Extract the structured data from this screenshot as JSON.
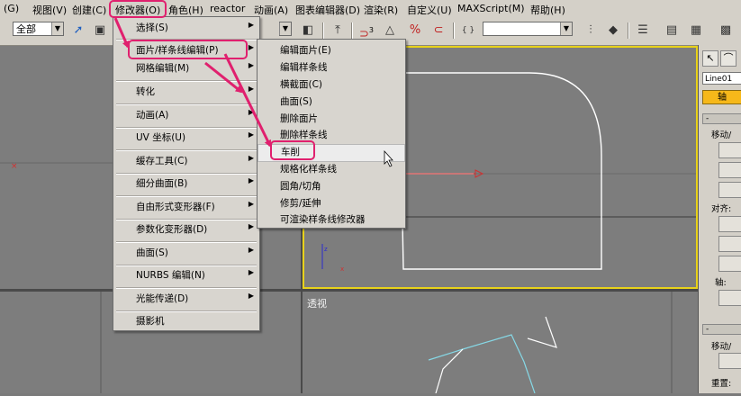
{
  "menubar": {
    "items": [
      "(G)",
      "视图(V)",
      "创建(C)",
      "修改器(O)",
      "角色(H)",
      "reactor",
      "动画(A)",
      "图表编辑器(D)",
      "渲染(R)",
      "自定义(U)",
      "MAXScript(M)",
      "帮助(H)"
    ]
  },
  "toolbar": {
    "selection_filter": "全部",
    "icons": [
      "select-arrow-icon",
      "select-region-icon",
      "mirror-icon",
      "snap-3d-icon",
      "angle-snap-icon",
      "percent-snap-icon",
      "spinner-snap-icon",
      "edit-named-selection-icon",
      "mirror-tool-icon",
      "align-tool-icon",
      "layer-manager-icon",
      "curve-editor-icon",
      "schematic-view-icon"
    ],
    "snap_label": "3"
  },
  "modifiers_menu": {
    "items": [
      "选择(S)",
      "面片/样条线编辑(P)",
      "网格编辑(M)",
      "转化",
      "动画(A)",
      "UV 坐标(U)",
      "缓存工具(C)",
      "细分曲面(B)",
      "自由形式变形器(F)",
      "参数化变形器(D)",
      "曲面(S)",
      "NURBS 编辑(N)",
      "光能传递(D)",
      "摄影机"
    ],
    "has_submenu": [
      true,
      true,
      true,
      true,
      true,
      true,
      true,
      true,
      true,
      true,
      true,
      true,
      true,
      false
    ]
  },
  "patch_spline_submenu": {
    "items": [
      "编辑面片(E)",
      "编辑样条线",
      "横截面(C)",
      "曲面(S)",
      "删除面片",
      "删除样条线",
      "车削",
      "规格化样条线",
      "圆角/切角",
      "修剪/延伸",
      "可渲染样条线修改器"
    ],
    "highlighted": "车削"
  },
  "viewports": {
    "perspective_label": "透视"
  },
  "command_panel": {
    "object_name": "Line01",
    "tab_label": "轴",
    "labels": [
      "移动/",
      "对齐:",
      "轴:",
      "移动/",
      "重置:"
    ]
  },
  "colors": {
    "highlight": "#e0206e",
    "active_viewport_border": "#e8d21a",
    "spline": "#ffffff",
    "axis_red": "#d23030",
    "perspective_wire": "#86d8e6"
  }
}
